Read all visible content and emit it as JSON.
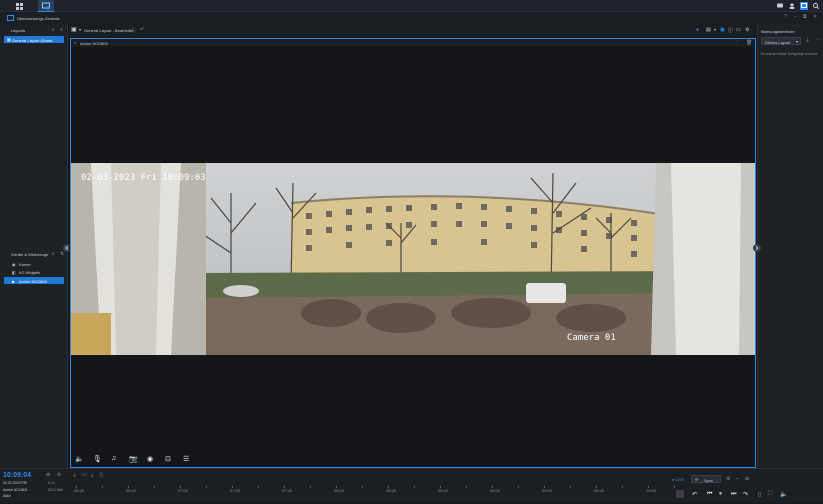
{
  "app": {
    "title": "Überwachungs-Zentrale"
  },
  "left": {
    "layouts_title": "Layouts",
    "layout_item": "General Layout (Stand.",
    "devices_title": "Geräte & Werkzeuge",
    "items": [
      {
        "label": "Karten",
        "icon": "map-icon"
      },
      {
        "label": "I/O-Widgets",
        "icon": "widget-icon"
      },
      {
        "label": "Annke NCD800",
        "icon": "camera-icon"
      }
    ]
  },
  "main": {
    "layout_name": "General Layout - Bearbeitet",
    "camera_name": "Annke NCD800",
    "osd_datetime": "02-03-2023 Fri 10:09:03",
    "osd_camera": "Camera 01"
  },
  "right": {
    "title": "Warnungsbereiche",
    "filter_label": "Dieses Layout",
    "empty_text": "Es wurden keine Ereignisse erkannt."
  },
  "timeline": {
    "current_time": "10:09:04",
    "current_date": "02.02.2023 FRI",
    "zoom": "6.1X",
    "camera": "Annke NCD800",
    "speed": "Aktiv",
    "small_value": "8212 Bitd",
    "live_label": "LIVE",
    "sync_label": "Sync",
    "ticks": [
      "06:20",
      "06:40",
      "07:00",
      "07:20",
      "07:40",
      "08:00",
      "08:20",
      "08:40",
      "09:00",
      "09:20",
      "09:40",
      "10:00"
    ]
  },
  "colors": {
    "accent": "#2d8cf0",
    "selected": "#1f7ad8",
    "record": "#e0403a"
  }
}
